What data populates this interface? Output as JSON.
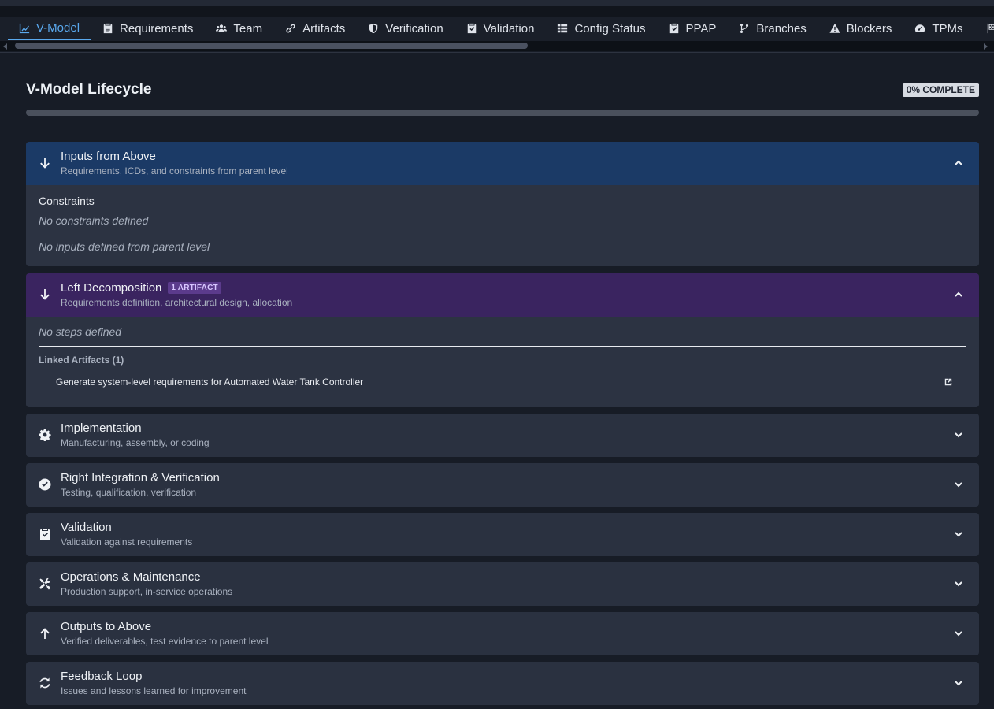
{
  "tabs": [
    {
      "label": "V-Model",
      "icon": "chart-line-icon",
      "active": true
    },
    {
      "label": "Requirements",
      "icon": "clipboard-list-icon",
      "active": false
    },
    {
      "label": "Team",
      "icon": "users-icon",
      "active": false
    },
    {
      "label": "Artifacts",
      "icon": "link-icon",
      "active": false
    },
    {
      "label": "Verification",
      "icon": "shield-icon",
      "active": false
    },
    {
      "label": "Validation",
      "icon": "clipboard-check-icon",
      "active": false
    },
    {
      "label": "Config Status",
      "icon": "table-list-icon",
      "active": false
    },
    {
      "label": "PPAP",
      "icon": "clipboard-check-icon",
      "active": false
    },
    {
      "label": "Branches",
      "icon": "code-branch-icon",
      "active": false
    },
    {
      "label": "Blockers",
      "icon": "warning-icon",
      "active": false
    },
    {
      "label": "TPMs",
      "icon": "gauge-icon",
      "active": false
    },
    {
      "label": "",
      "icon": "flag-checkered-icon",
      "active": false
    }
  ],
  "main": {
    "title": "V-Model Lifecycle",
    "complete_badge": "0% COMPLETE",
    "progress_percent": 0
  },
  "phases": [
    {
      "title": "Inputs from Above",
      "subtitle": "Requirements, ICDs, and constraints from parent level",
      "icon": "arrow-down-icon",
      "expanded": true,
      "header_color": "#1b3a66",
      "constraints_label": "Constraints",
      "constraints_empty": "No constraints defined",
      "inputs_empty": "No inputs defined from parent level"
    },
    {
      "title": "Left Decomposition",
      "subtitle": "Requirements definition, architectural design, allocation",
      "icon": "arrow-down-icon",
      "expanded": true,
      "header_color": "#3a2460",
      "badge": "1 ARTIFACT",
      "steps_empty": "No steps defined",
      "linked_title": "Linked Artifacts (1)",
      "artifacts": [
        "Generate system-level requirements for Automated Water Tank Controller"
      ]
    },
    {
      "title": "Implementation",
      "subtitle": "Manufacturing, assembly, or coding",
      "icon": "gear-icon",
      "expanded": false
    },
    {
      "title": "Right Integration & Verification",
      "subtitle": "Testing, qualification, verification",
      "icon": "check-circle-icon",
      "expanded": false
    },
    {
      "title": "Validation",
      "subtitle": "Validation against requirements",
      "icon": "clipboard-check-icon",
      "expanded": false
    },
    {
      "title": "Operations & Maintenance",
      "subtitle": "Production support, in-service operations",
      "icon": "tools-icon",
      "expanded": false
    },
    {
      "title": "Outputs to Above",
      "subtitle": "Verified deliverables, test evidence to parent level",
      "icon": "arrow-up-icon",
      "expanded": false
    },
    {
      "title": "Feedback Loop",
      "subtitle": "Issues and lessons learned for improvement",
      "icon": "sync-icon",
      "expanded": false
    }
  ]
}
